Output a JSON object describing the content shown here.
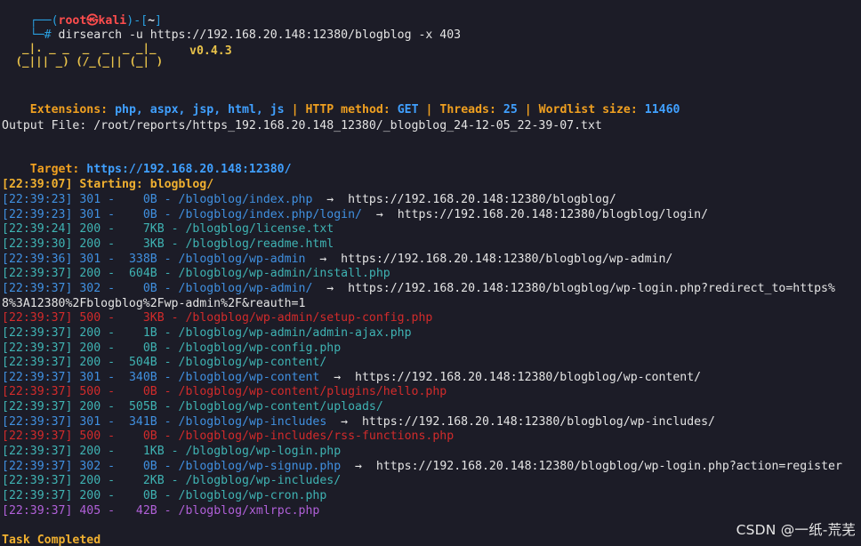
{
  "prompt": {
    "bracket_open": "┌──(",
    "user": "root㉿kali",
    "bracket_mid": ")-[",
    "dir": "~",
    "bracket_close": "]",
    "arrow": "└─#",
    "command": "dirsearch -u https://192.168.20.148:12380/blogblog -x 403"
  },
  "banner": {
    "art": "  _|. _ _  _  _  _ _|_\n (_||| _) (/_(_|| (_| )",
    "version": "v0.4.3"
  },
  "config": {
    "extensions_label": "Extensions:",
    "extensions_value": "php, aspx, jsp, html, js",
    "sep": "|",
    "method_label": "HTTP method:",
    "method_value": "GET",
    "threads_label": "Threads:",
    "threads_value": "25",
    "wordlist_label": "Wordlist size:",
    "wordlist_value": "11460"
  },
  "output_file": "Output File: /root/reports/https_192.168.20.148_12380/_blogblog_24-12-05_22-39-07.txt",
  "target": {
    "label": "Target:",
    "value": "https://192.168.20.148:12380/"
  },
  "starting": "[22:39:07] Starting: blogblog/",
  "results": [
    {
      "time": "[22:39:23]",
      "code": "301",
      "size": "   0B",
      "path": "/blogblog/index.php",
      "redirect": "https://192.168.20.148:12380/blogblog/",
      "color": "blue"
    },
    {
      "time": "[22:39:23]",
      "code": "301",
      "size": "   0B",
      "path": "/blogblog/index.php/login/",
      "redirect": "https://192.168.20.148:12380/blogblog/login/",
      "color": "blue"
    },
    {
      "time": "[22:39:24]",
      "code": "200",
      "size": "   7KB",
      "path": "/blogblog/license.txt",
      "redirect": "",
      "color": "green"
    },
    {
      "time": "[22:39:30]",
      "code": "200",
      "size": "   3KB",
      "path": "/blogblog/readme.html",
      "redirect": "",
      "color": "green"
    },
    {
      "time": "[22:39:36]",
      "code": "301",
      "size": " 338B",
      "path": "/blogblog/wp-admin",
      "redirect": "https://192.168.20.148:12380/blogblog/wp-admin/",
      "color": "blue"
    },
    {
      "time": "[22:39:37]",
      "code": "200",
      "size": " 604B",
      "path": "/blogblog/wp-admin/install.php",
      "redirect": "",
      "color": "green"
    },
    {
      "time": "[22:39:37]",
      "code": "302",
      "size": "   0B",
      "path": "/blogblog/wp-admin/",
      "redirect": "https://192.168.20.148:12380/blogblog/wp-login.php?redirect_to=https%",
      "color": "blue"
    },
    {
      "time": "",
      "code": "",
      "size": "",
      "path": "",
      "redirect": "",
      "continuation": "8%3A12380%2Fblogblog%2Fwp-admin%2F&reauth=1",
      "color": "white"
    },
    {
      "time": "[22:39:37]",
      "code": "500",
      "size": "   3KB",
      "path": "/blogblog/wp-admin/setup-config.php",
      "redirect": "",
      "color": "red"
    },
    {
      "time": "[22:39:37]",
      "code": "200",
      "size": "   1B",
      "path": "/blogblog/wp-admin/admin-ajax.php",
      "redirect": "",
      "color": "green"
    },
    {
      "time": "[22:39:37]",
      "code": "200",
      "size": "   0B",
      "path": "/blogblog/wp-config.php",
      "redirect": "",
      "color": "green"
    },
    {
      "time": "[22:39:37]",
      "code": "200",
      "size": " 504B",
      "path": "/blogblog/wp-content/",
      "redirect": "",
      "color": "green"
    },
    {
      "time": "[22:39:37]",
      "code": "301",
      "size": " 340B",
      "path": "/blogblog/wp-content",
      "redirect": "https://192.168.20.148:12380/blogblog/wp-content/",
      "color": "blue"
    },
    {
      "time": "[22:39:37]",
      "code": "500",
      "size": "   0B",
      "path": "/blogblog/wp-content/plugins/hello.php",
      "redirect": "",
      "color": "red"
    },
    {
      "time": "[22:39:37]",
      "code": "200",
      "size": " 505B",
      "path": "/blogblog/wp-content/uploads/",
      "redirect": "",
      "color": "green"
    },
    {
      "time": "[22:39:37]",
      "code": "301",
      "size": " 341B",
      "path": "/blogblog/wp-includes",
      "redirect": "https://192.168.20.148:12380/blogblog/wp-includes/",
      "color": "blue"
    },
    {
      "time": "[22:39:37]",
      "code": "500",
      "size": "   0B",
      "path": "/blogblog/wp-includes/rss-functions.php",
      "redirect": "",
      "color": "red"
    },
    {
      "time": "[22:39:37]",
      "code": "200",
      "size": "   1KB",
      "path": "/blogblog/wp-login.php",
      "redirect": "",
      "color": "green"
    },
    {
      "time": "[22:39:37]",
      "code": "302",
      "size": "   0B",
      "path": "/blogblog/wp-signup.php",
      "redirect": "https://192.168.20.148:12380/blogblog/wp-login.php?action=register",
      "color": "blue"
    },
    {
      "time": "[22:39:37]",
      "code": "200",
      "size": "   2KB",
      "path": "/blogblog/wp-includes/",
      "redirect": "",
      "color": "green"
    },
    {
      "time": "[22:39:37]",
      "code": "200",
      "size": "   0B",
      "path": "/blogblog/wp-cron.php",
      "redirect": "",
      "color": "green"
    },
    {
      "time": "[22:39:37]",
      "code": "405",
      "size": "  42B",
      "path": "/blogblog/xmlrpc.php",
      "redirect": "",
      "color": "purple"
    }
  ],
  "task_completed": "Task Completed",
  "watermark": "CSDN @一纸-荒芜",
  "colors": {
    "background": "#1c1c27",
    "blue": "#4090e0",
    "green": "#3fb3b3",
    "red": "#d22b2b",
    "purple": "#b060d8",
    "accent_orange": "#f0a020",
    "accent_cyan": "#40a0ff"
  }
}
